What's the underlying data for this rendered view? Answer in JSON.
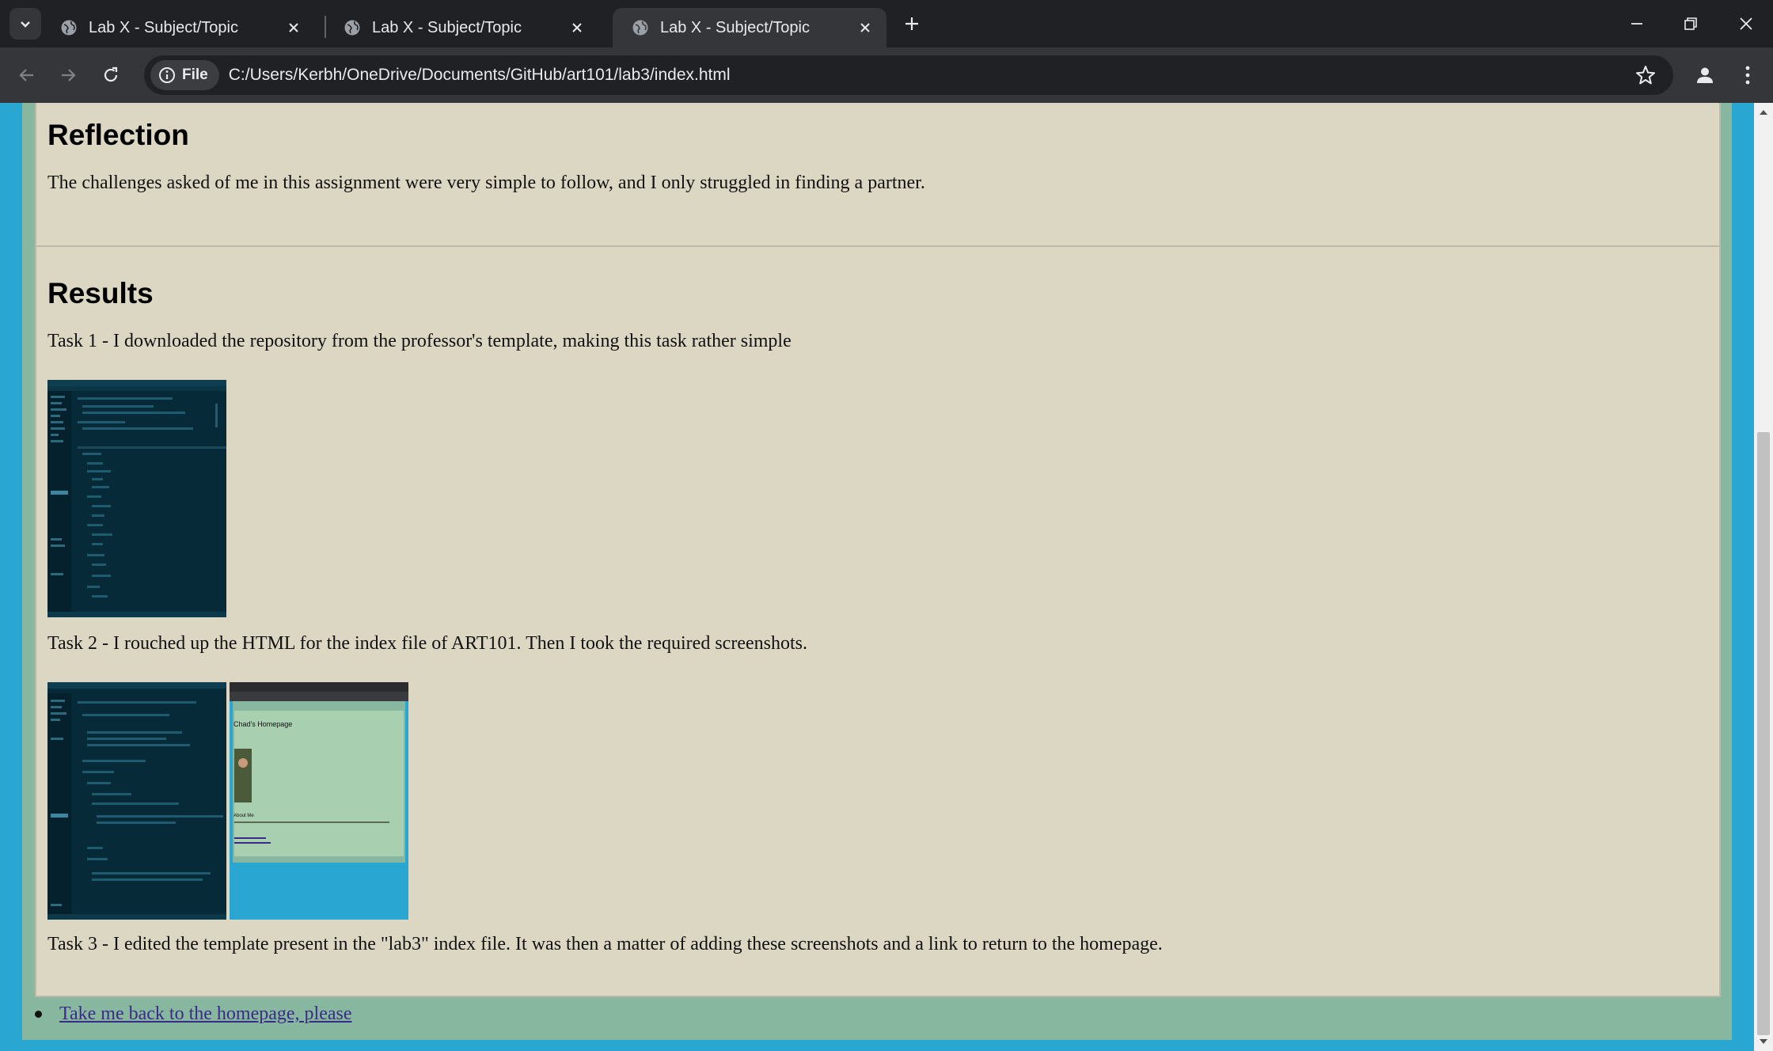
{
  "browser": {
    "tabs": [
      {
        "title": "Lab X - Subject/Topic",
        "active": false
      },
      {
        "title": "Lab X - Subject/Topic",
        "active": false
      },
      {
        "title": "Lab X - Subject/Topic",
        "active": true
      }
    ],
    "omnibox": {
      "security_chip": "File",
      "url": "C:/Users/Kerbh/OneDrive/Documents/GitHub/art101/lab3/index.html"
    }
  },
  "page": {
    "reflection": {
      "heading": "Reflection",
      "text": "The challenges asked of me in this assignment were very simple to follow, and I only struggled in finding a partner."
    },
    "results": {
      "heading": "Results",
      "task1": "Task 1 - I downloaded the repository from the professor's template, making this task rather simple",
      "task2": "Task 2 - I rouched up the HTML for the index file of ART101. Then I took the required screenshots.",
      "task3": "Task 3 - I edited the template present in the \"lab3\" index file. It was then a matter of adding these screenshots and a link to return to the homepage.",
      "thumb_text": {
        "homepage_title": "Chad's Homepage",
        "about_heading": "About Me"
      }
    },
    "back_link": "Take me back to the homepage, please"
  },
  "colors": {
    "page_background": "#2aa6d2",
    "wrapper_background": "#87b89f",
    "section_background": "#dcd7c3",
    "link": "#3b2b88"
  }
}
